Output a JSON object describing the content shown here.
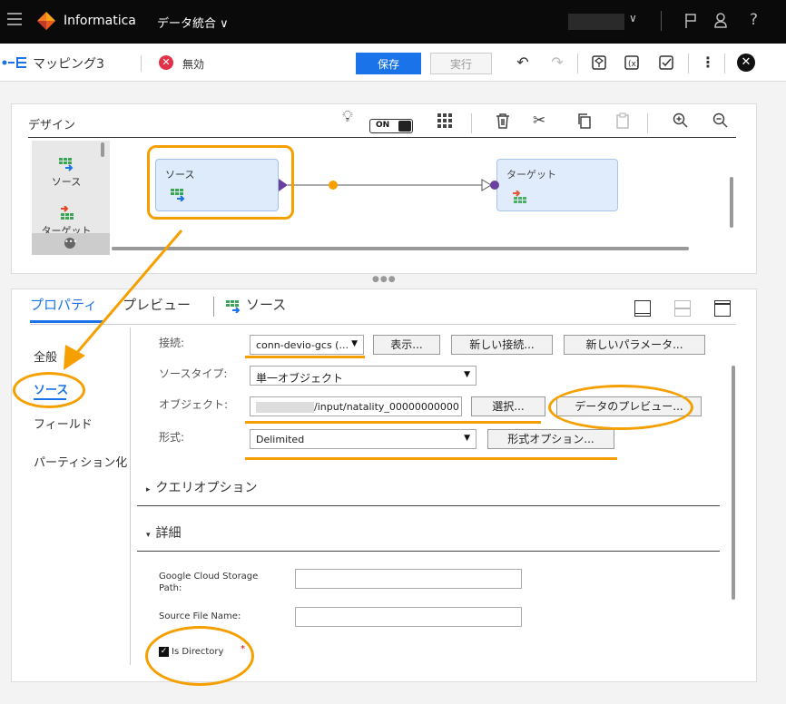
{
  "topbar": {
    "app_name": "Informatica",
    "app_sub": "データ統合 ∨",
    "help_label": "?"
  },
  "toolbar": {
    "mapping_title": "マッピング3",
    "status_label": "無効",
    "save_label": "保存",
    "run_label": "実行"
  },
  "design": {
    "title": "デザイン",
    "toggle_label": "ON",
    "palette": [
      {
        "label": "ソース"
      },
      {
        "label": "ターゲット"
      }
    ],
    "nodes": {
      "source_label": "ソース",
      "target_label": "ターゲット"
    }
  },
  "properties": {
    "tabs": [
      "プロパティ",
      "プレビュー"
    ],
    "object_label": "ソース",
    "side_items": [
      "全般",
      "ソース",
      "フィールド",
      "パーティション化"
    ],
    "fields": {
      "connection_label": "接続:",
      "connection_value": "conn-devio-gcs (...",
      "show_button": "表示...",
      "new_connection_button": "新しい接続...",
      "new_parameter_button": "新しいパラメータ...",
      "source_type_label": "ソースタイプ:",
      "source_type_value": "単一オブジェクト",
      "object_label": "オブジェクト:",
      "object_value": "/input/natality_00000000000",
      "select_button": "選択...",
      "preview_button": "データのプレビュー...",
      "format_label": "形式:",
      "format_value": "Delimited",
      "format_options_button": "形式オプション..."
    },
    "sections": {
      "query_options": "クエリオプション",
      "details": "詳細"
    },
    "details": {
      "gcs_path_label": "Google Cloud Storage Path:",
      "gcs_path_value": "",
      "source_file_label": "Source File Name:",
      "source_file_value": "",
      "is_directory_label": "Is Directory",
      "is_directory_checked": true,
      "required_mark": "*"
    }
  },
  "colors": {
    "accent": "#1a73e8",
    "annotation": "#f5a000",
    "invalid": "#e0334a",
    "node_fill": "#ddebfb"
  }
}
